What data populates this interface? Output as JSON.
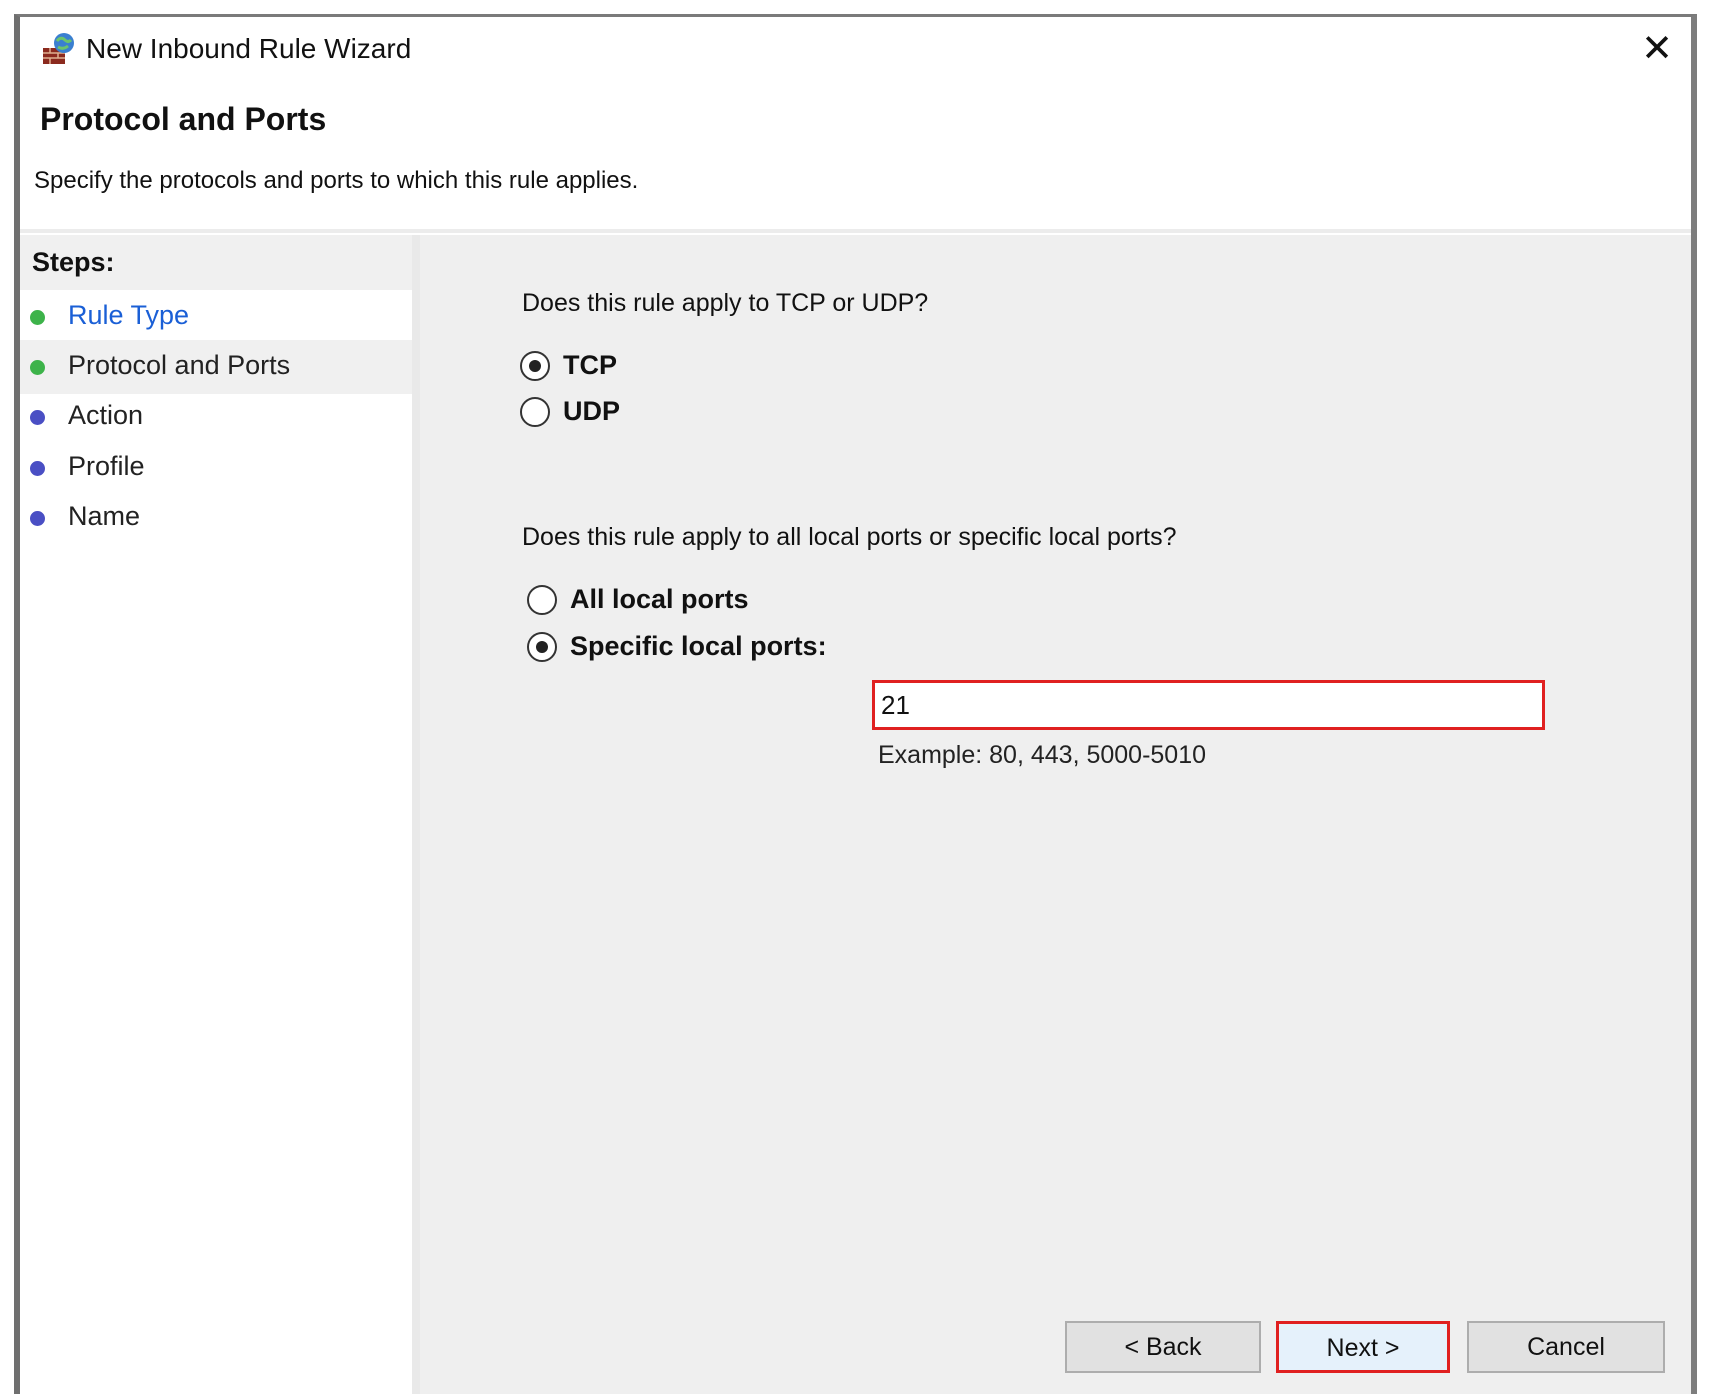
{
  "window": {
    "title": "New Inbound Rule Wizard",
    "close_glyph": "✕"
  },
  "header": {
    "title": "Protocol and Ports",
    "description": "Specify the protocols and ports to which this rule applies."
  },
  "steps": {
    "heading": "Steps:",
    "items": [
      {
        "label": "Rule Type",
        "state": "completed-link",
        "dot_color": "#3db34a"
      },
      {
        "label": "Protocol and Ports",
        "state": "current",
        "dot_color": "#3db34a"
      },
      {
        "label": "Action",
        "state": "pending",
        "dot_color": "#4a4fc4"
      },
      {
        "label": "Profile",
        "state": "pending",
        "dot_color": "#4a4fc4"
      },
      {
        "label": "Name",
        "state": "pending",
        "dot_color": "#4a4fc4"
      }
    ]
  },
  "protocol": {
    "question": "Does this rule apply to TCP or UDP?",
    "options": [
      {
        "label": "TCP",
        "selected": true
      },
      {
        "label": "UDP",
        "selected": false
      }
    ]
  },
  "ports": {
    "question": "Does this rule apply to all local ports or specific local ports?",
    "options": [
      {
        "label": "All local ports",
        "selected": false
      },
      {
        "label": "Specific local ports:",
        "selected": true
      }
    ],
    "value": "21",
    "example": "Example: 80, 443, 5000-5010"
  },
  "buttons": {
    "back": "< Back",
    "next": "Next >",
    "cancel": "Cancel"
  },
  "icons": {
    "title_icon": "firewall-icon",
    "close_icon": "close-icon"
  },
  "colors": {
    "highlight_border": "#e02020",
    "link": "#1a5fd6"
  }
}
